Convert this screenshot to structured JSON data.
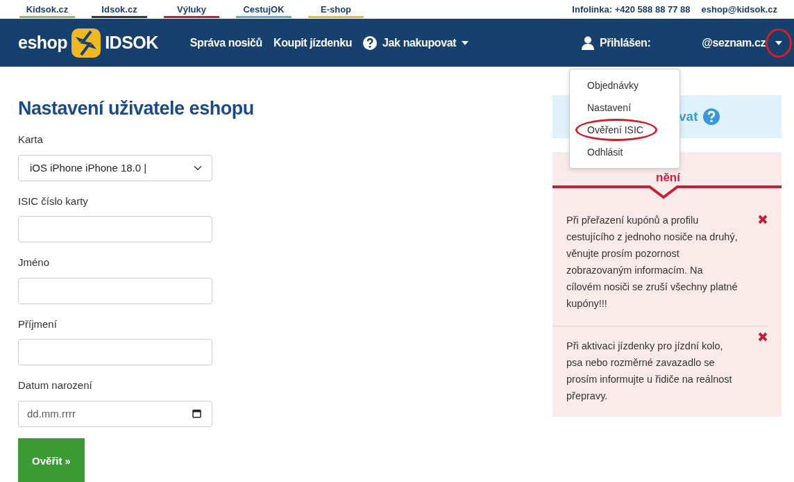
{
  "top_links": [
    {
      "label": "Kidsok.cz",
      "color": "#8cc04b"
    },
    {
      "label": "Idsok.cz",
      "color": "#1b3d6b"
    },
    {
      "label": "Výluky",
      "color": "#c4203a"
    },
    {
      "label": "CestujOK",
      "color": "#5aaedc"
    },
    {
      "label": "E-shop",
      "color": "#f0b823"
    }
  ],
  "contact": {
    "phone": "Infolinka: +420 588 88 77 88",
    "email": "eshop@kidsok.cz"
  },
  "logo": {
    "left": "eshop",
    "right": "IDSOK"
  },
  "nav": [
    {
      "label": "Správa nosičů",
      "kind": "link"
    },
    {
      "label": "Koupit jízdenku",
      "kind": "link"
    },
    {
      "label": "Jak nakupovat",
      "kind": "dropdown"
    }
  ],
  "user": {
    "label": "Přihlášen:",
    "email": "@seznam.cz",
    "highlighted": true
  },
  "user_menu": [
    {
      "label": "Objednávky",
      "highlighted": false
    },
    {
      "label": "Nastavení",
      "highlighted": false
    },
    {
      "label": "Ověření ISIC",
      "highlighted": true
    },
    {
      "label": "Odhlásit",
      "highlighted": false
    }
  ],
  "page_title": "Nastavení uživatele eshopu",
  "form": [
    {
      "label": "Karta",
      "kind": "select",
      "value": "iOS iPhone iPhone 18.0 |"
    },
    {
      "label": "ISIC číslo karty",
      "kind": "text"
    },
    {
      "label": "Jméno",
      "kind": "text"
    },
    {
      "label": "Příjmení",
      "kind": "text"
    },
    {
      "label": "Datum narození",
      "kind": "date",
      "placeholder": "dd.mm.rrrr"
    }
  ],
  "submit": "Ověřit »",
  "info_box": {
    "text": "vat"
  },
  "alerts": {
    "heading": "nění",
    "messages": [
      "Při přeřazení kupónů a profilu cestujícího z jednoho nosiče na druhý, věnujte prosím pozornost zobrazovaným informacím. Na cílovém nosiči se zruší všechny platné kupóny!!!",
      "Při aktivaci jízdenky pro jízdní kolo, psa nebo rozměrné zavazadlo se prosím informujte u řidiče na reálnost přepravy."
    ]
  }
}
